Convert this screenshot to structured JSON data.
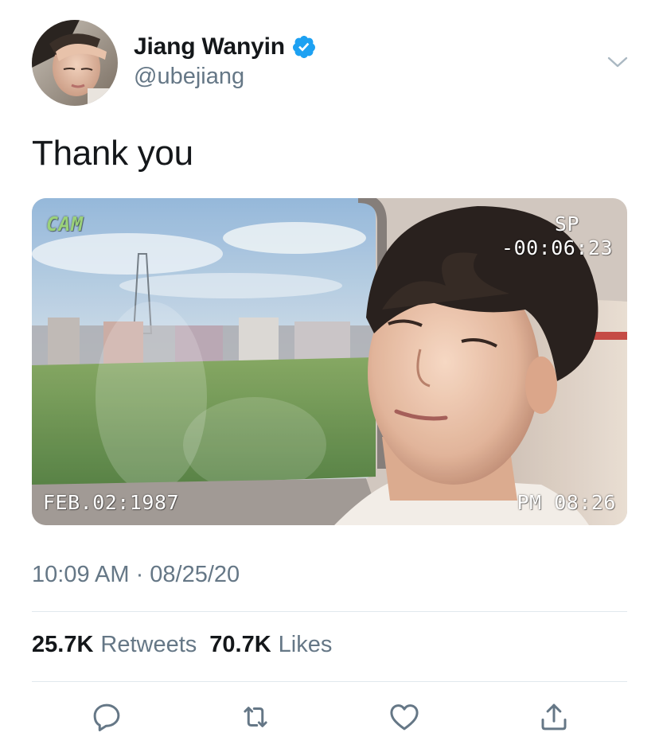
{
  "author": {
    "name": "Jiang Wanyin",
    "handle": "@ubejiang",
    "verified": true,
    "avatar_icon": "profile-photo"
  },
  "tweet": {
    "text": "Thank you",
    "timestamp": "10:09 AM · 08/25/20"
  },
  "media": {
    "overlay": {
      "cam": "CAM",
      "sp": "SP",
      "counter": "-00:06:23",
      "date": "FEB.02:1987",
      "clock": "PM 08:26"
    }
  },
  "stats": {
    "retweets_count": "25.7K",
    "retweets_label": "Retweets",
    "likes_count": "70.7K",
    "likes_label": "Likes"
  },
  "actions": [
    {
      "name": "reply",
      "icon": "reply-icon"
    },
    {
      "name": "retweet",
      "icon": "retweet-icon"
    },
    {
      "name": "like",
      "icon": "heart-icon"
    },
    {
      "name": "share",
      "icon": "share-icon"
    }
  ],
  "colors": {
    "verified_blue": "#1da1f2",
    "secondary_text": "#657786",
    "primary_text": "#14171a",
    "divider": "#e1e8ed",
    "action_icon": "#657786"
  }
}
